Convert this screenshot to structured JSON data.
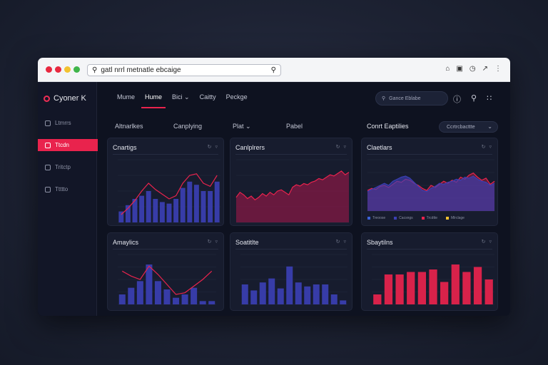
{
  "browser": {
    "address": "gatl nrrl metnatle ebcaige",
    "dot_colors": [
      "#e8283f",
      "#e8283f",
      "#f2c230",
      "#3fb54a"
    ]
  },
  "app": {
    "brand": "Cyoner K",
    "sidebar": [
      {
        "label": "Ltmrrs",
        "active": false
      },
      {
        "label": "Ttcdn",
        "active": true
      },
      {
        "label": "Tritctp",
        "active": false
      },
      {
        "label": "Ttttto",
        "active": false
      }
    ],
    "topnav": [
      {
        "label": "Mume",
        "active": false
      },
      {
        "label": "Hume",
        "active": true
      },
      {
        "label": "Bici ⌄",
        "active": false
      },
      {
        "label": "Caitty",
        "active": false
      },
      {
        "label": "Peckge",
        "active": false
      }
    ],
    "search_placeholder": "Gance Eblabe",
    "subnav": [
      "Altnarlkes",
      "Canplying",
      "Plat ⌄",
      "Pabel"
    ],
    "section_title": "Conrt Eaptilies",
    "filter_label": "Ccrtrcbacttte",
    "accent": "#e9234d",
    "series_blue": "#3b3fb3",
    "series_red": "#e9234d"
  },
  "cards": [
    {
      "title": "Cnartigs"
    },
    {
      "title": "Canlplrers"
    },
    {
      "title": "Claetlars"
    },
    {
      "title": "Amaylics"
    },
    {
      "title": "Soatitlte"
    },
    {
      "title": "Sbaytilns"
    }
  ],
  "legend": [
    {
      "label": "Treoose",
      "color": "#3b62d8"
    },
    {
      "label": "Cacsngs",
      "color": "#3b3fb3"
    },
    {
      "label": "Trcdtte",
      "color": "#e9234d"
    },
    {
      "label": "Mlrclage",
      "color": "#f2c230"
    }
  ],
  "chart_data": [
    {
      "type": "bar",
      "title": "Cnartigs",
      "values": [
        14,
        22,
        30,
        34,
        40,
        30,
        26,
        24,
        30,
        44,
        52,
        48,
        40,
        40,
        52
      ],
      "line": [
        10,
        18,
        28,
        40,
        50,
        42,
        36,
        30,
        34,
        50,
        60,
        62,
        50,
        46,
        60
      ],
      "ylim": [
        0,
        80
      ],
      "color": "#3b3fb3"
    },
    {
      "type": "area",
      "title": "Canlplrers",
      "values": [
        40,
        48,
        44,
        38,
        42,
        36,
        40,
        46,
        42,
        48,
        44,
        50,
        52,
        48,
        44,
        56,
        60,
        58,
        62,
        60,
        64,
        66,
        70,
        68,
        72,
        76,
        74,
        78,
        82,
        76,
        80
      ],
      "ylim": [
        0,
        100
      ],
      "color": "#e9234d"
    },
    {
      "type": "area",
      "title": "Claetlars",
      "series": [
        {
          "values": [
            40,
            44,
            42,
            48,
            50,
            46,
            52,
            58,
            56,
            62,
            60,
            54,
            50,
            44,
            40,
            50,
            46,
            52,
            58,
            54,
            60,
            56,
            66,
            62,
            70,
            74,
            66,
            60,
            64,
            52,
            58
          ]
        },
        {
          "values": [
            38,
            42,
            46,
            50,
            54,
            50,
            58,
            62,
            66,
            68,
            64,
            56,
            48,
            40,
            38,
            44,
            48,
            54,
            52,
            56,
            58,
            62,
            60,
            66,
            64,
            68,
            62,
            58,
            56,
            50,
            54
          ]
        }
      ],
      "ylim": [
        0,
        100
      ]
    },
    {
      "type": "bar",
      "title": "Amaylics",
      "values": [
        12,
        20,
        28,
        48,
        28,
        18,
        8,
        12,
        20,
        4,
        4
      ],
      "line": [
        40,
        34,
        30,
        46,
        36,
        24,
        12,
        14,
        22,
        30,
        40
      ],
      "ylim": [
        0,
        60
      ],
      "color": "#3b3fb3"
    },
    {
      "type": "bar",
      "title": "Soatitlte",
      "values": [
        20,
        14,
        22,
        26,
        16,
        38,
        22,
        18,
        20,
        20,
        10,
        4
      ],
      "ylim": [
        0,
        50
      ],
      "color": "#3b3fb3"
    },
    {
      "type": "bar",
      "title": "Sbaytilns",
      "values": [
        8,
        24,
        24,
        26,
        26,
        28,
        18,
        32,
        26,
        30,
        20
      ],
      "ylim": [
        0,
        40
      ],
      "color": "#e9234d"
    }
  ]
}
